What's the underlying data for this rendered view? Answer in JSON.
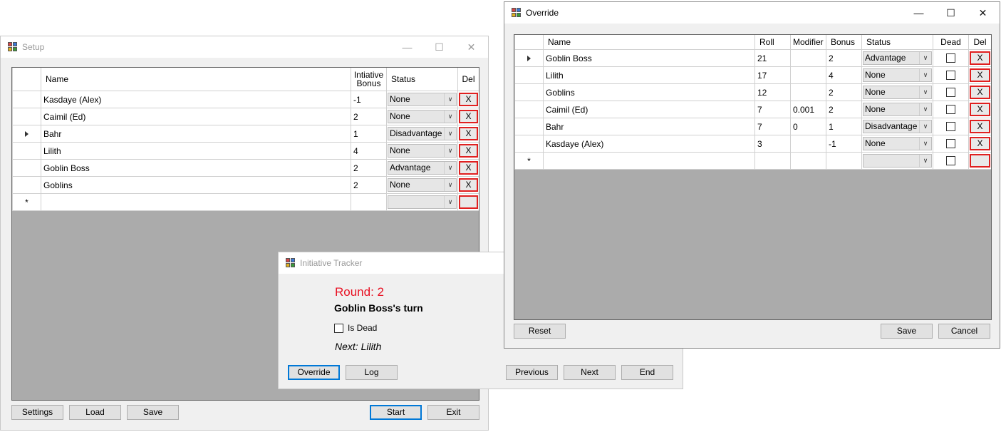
{
  "setup": {
    "title": "Setup",
    "minimize": "—",
    "maximize": "☐",
    "close": "✕",
    "columns": {
      "name": "Name",
      "bonus": "Intiative Bonus",
      "status": "Status",
      "del": "Del"
    },
    "rows": [
      {
        "name": "Kasdaye (Alex)",
        "bonus": "-1",
        "status": "None",
        "del": "X",
        "current": false
      },
      {
        "name": "Caimil (Ed)",
        "bonus": "2",
        "status": "None",
        "del": "X",
        "current": false
      },
      {
        "name": "Bahr",
        "bonus": "1",
        "status": "Disadvantage",
        "del": "X",
        "current": true
      },
      {
        "name": "Lilith",
        "bonus": "4",
        "status": "None",
        "del": "X",
        "current": false
      },
      {
        "name": "Goblin Boss",
        "bonus": "2",
        "status": "Advantage",
        "del": "X",
        "current": false
      },
      {
        "name": "Goblins",
        "bonus": "2",
        "status": "None",
        "del": "X",
        "current": false
      }
    ],
    "new_row_marker": "*",
    "buttons": {
      "settings": "Settings",
      "load": "Load",
      "save": "Save",
      "start": "Start",
      "exit": "Exit"
    }
  },
  "tracker": {
    "title": "Initiative Tracker",
    "round": "Round: 2",
    "turn": "Goblin Boss's turn",
    "is_dead_label": "Is Dead",
    "next": "Next: Lilith",
    "buttons": {
      "override": "Override",
      "log": "Log",
      "previous": "Previous",
      "next": "Next",
      "end": "End"
    }
  },
  "override": {
    "title": "Override",
    "minimize": "—",
    "maximize": "☐",
    "close": "✕",
    "columns": {
      "name": "Name",
      "roll": "Roll",
      "modifier": "Modifier",
      "bonus": "Bonus",
      "status": "Status",
      "dead": "Dead",
      "del": "Del"
    },
    "rows": [
      {
        "name": "Goblin Boss",
        "roll": "21",
        "modifier": "",
        "bonus": "2",
        "status": "Advantage",
        "del": "X",
        "current": true
      },
      {
        "name": "Lilith",
        "roll": "17",
        "modifier": "",
        "bonus": "4",
        "status": "None",
        "del": "X",
        "current": false
      },
      {
        "name": "Goblins",
        "roll": "12",
        "modifier": "",
        "bonus": "2",
        "status": "None",
        "del": "X",
        "current": false
      },
      {
        "name": "Caimil (Ed)",
        "roll": "7",
        "modifier": "0.001",
        "bonus": "2",
        "status": "None",
        "del": "X",
        "current": false
      },
      {
        "name": "Bahr",
        "roll": "7",
        "modifier": "0",
        "bonus": "1",
        "status": "Disadvantage",
        "del": "X",
        "current": false
      },
      {
        "name": "Kasdaye (Alex)",
        "roll": "3",
        "modifier": "",
        "bonus": "-1",
        "status": "None",
        "del": "X",
        "current": false
      }
    ],
    "new_row_marker": "*",
    "buttons": {
      "reset": "Reset",
      "save": "Save",
      "cancel": "Cancel"
    }
  },
  "colors": {
    "round_text": "#e81123",
    "del_border": "#e02020",
    "default_button_border": "#0078d7",
    "grid_background": "#ababab"
  }
}
